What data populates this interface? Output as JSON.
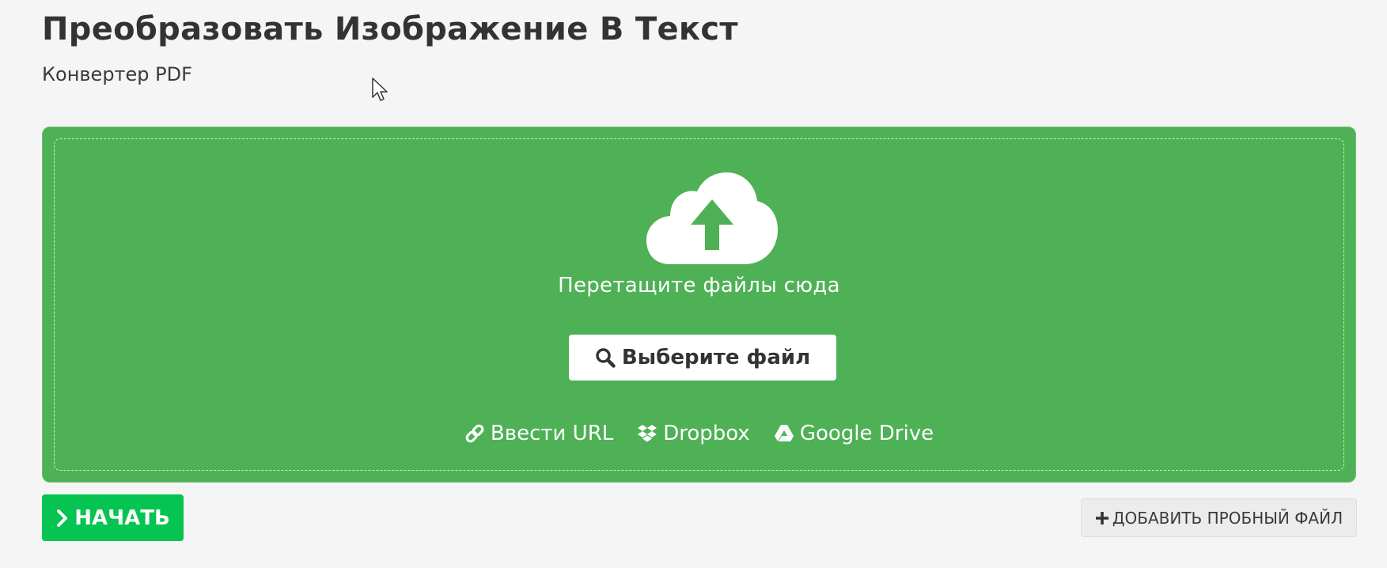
{
  "header": {
    "title": "Преобразовать Изображение В Текст",
    "subtitle": "Конвертер PDF"
  },
  "upload": {
    "icon": "cloud-upload-icon",
    "drop_text": "Перетащите файлы сюда",
    "choose_button_label": "Выберите файл",
    "sources": [
      {
        "label": "Ввести URL",
        "icon": "link-icon"
      },
      {
        "label": "Dropbox",
        "icon": "dropbox-icon"
      },
      {
        "label": "Google Drive",
        "icon": "google-drive-icon"
      }
    ]
  },
  "actions": {
    "start_label": "НАЧАТЬ",
    "sample_label": "ДОБАВИТЬ ПРОБНЫЙ ФАЙЛ"
  },
  "colors": {
    "panel_green": "#4eb155",
    "start_green": "#05c451",
    "text_dark": "#333333"
  }
}
